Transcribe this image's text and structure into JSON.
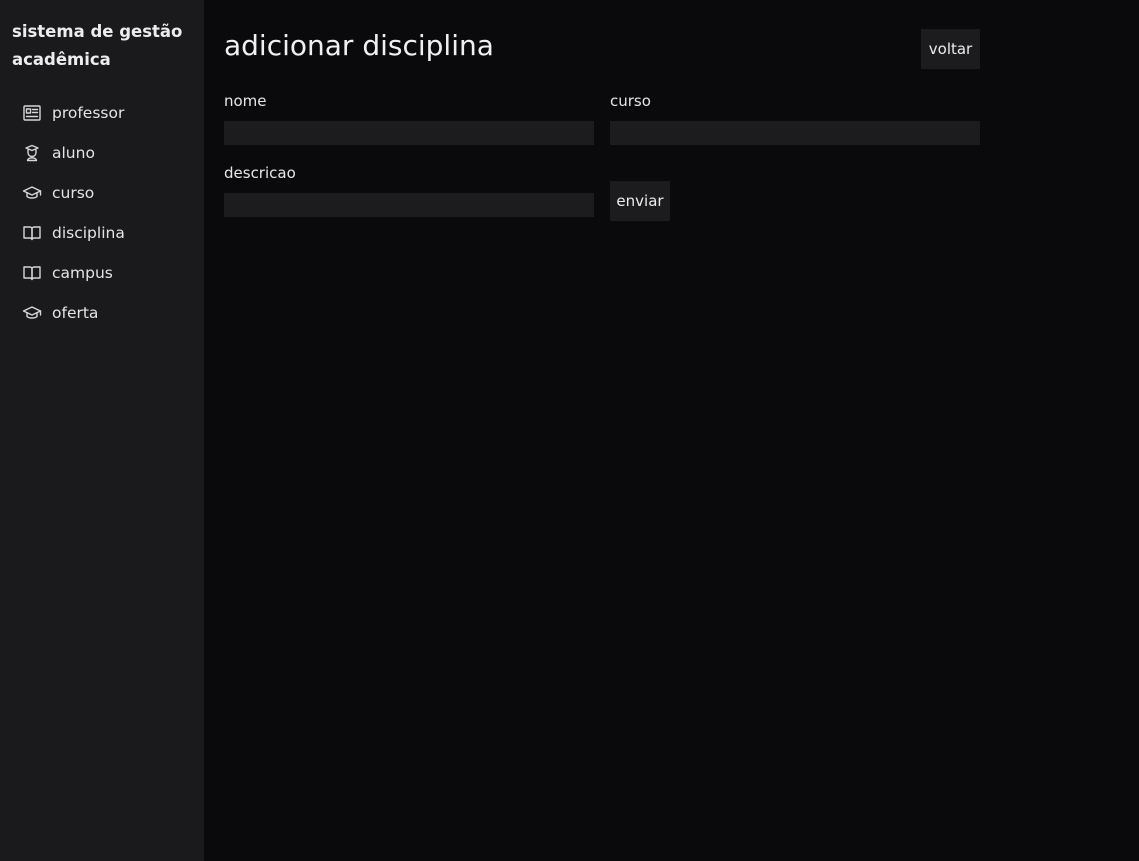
{
  "sidebar": {
    "brand": "sistema de gestão acadêmica",
    "items": [
      {
        "label": "professor",
        "icon": "id-card-icon"
      },
      {
        "label": "aluno",
        "icon": "student-icon"
      },
      {
        "label": "curso",
        "icon": "graduation-cap-icon"
      },
      {
        "label": "disciplina",
        "icon": "book-icon"
      },
      {
        "label": "campus",
        "icon": "book-icon"
      },
      {
        "label": "oferta",
        "icon": "graduation-cap-icon"
      }
    ]
  },
  "main": {
    "title": "adicionar disciplina",
    "back_label": "voltar",
    "submit_label": "enviar",
    "fields": {
      "nome": {
        "label": "nome",
        "value": ""
      },
      "curso": {
        "label": "curso",
        "value": ""
      },
      "descricao": {
        "label": "descricao",
        "value": ""
      }
    }
  },
  "colors": {
    "background": "#0a0a0c",
    "sidebar": "#1a1a1d",
    "input": "#1c1c1f",
    "text": "#e8e8ea"
  }
}
